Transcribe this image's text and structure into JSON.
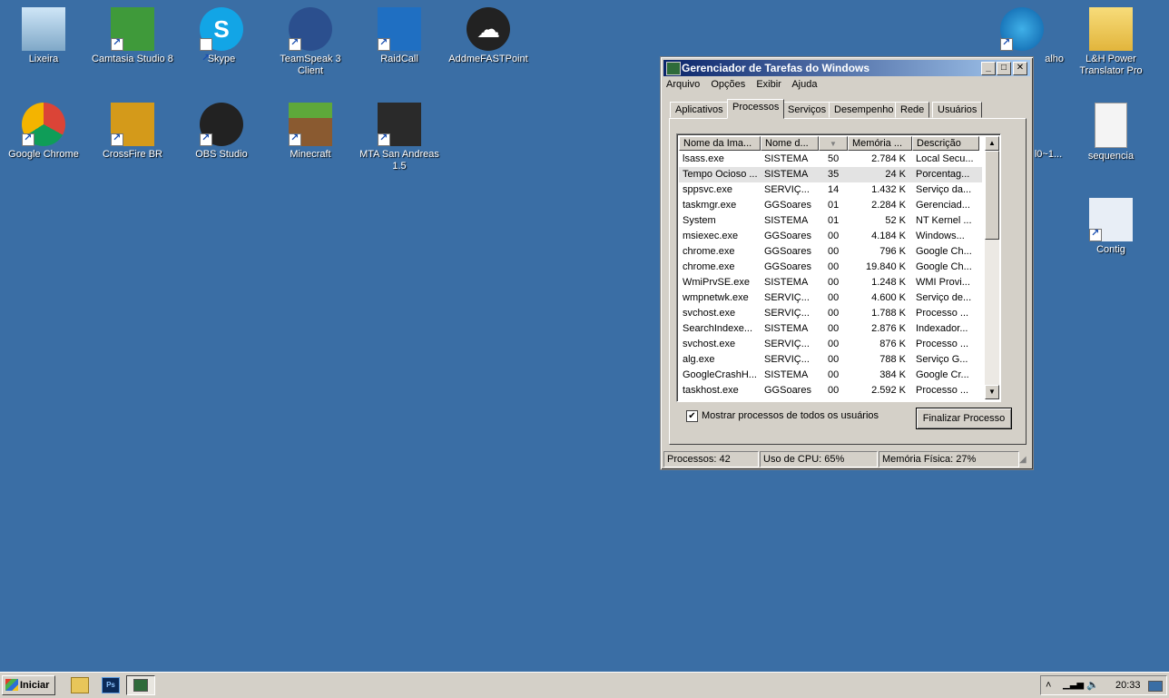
{
  "desktop_icons_left": [
    {
      "label": "Lixeira"
    },
    {
      "label": "Camtasia Studio 8"
    },
    {
      "label": "Skype"
    },
    {
      "label": "TeamSpeak 3 Client"
    },
    {
      "label": "RaidCall"
    },
    {
      "label": "AddmeFASTPoint"
    },
    {
      "label": "Google Chrome"
    },
    {
      "label": "CrossFire BR"
    },
    {
      "label": "OBS Studio"
    },
    {
      "label": "Minecraft"
    },
    {
      "label": "MTA San Andreas 1.5"
    }
  ],
  "desktop_icons_right": [
    {
      "label": "alho"
    },
    {
      "label": "L&H Power Translator Pro"
    },
    {
      "label": "l0~1..."
    },
    {
      "label": "sequencia"
    },
    {
      "label": "Contig"
    }
  ],
  "task_manager": {
    "title": "Gerenciador de Tarefas do Windows",
    "menu": [
      "Arquivo",
      "Opções",
      "Exibir",
      "Ajuda"
    ],
    "tabs": [
      "Aplicativos",
      "Processos",
      "Serviços",
      "Desempenho",
      "Rede",
      "Usuários"
    ],
    "active_tab": "Processos",
    "columns": [
      "Nome da Ima...",
      "Nome d...",
      "",
      "Memória ...",
      "Descrição"
    ],
    "rows": [
      {
        "name": "lsass.exe",
        "user": "SISTEMA",
        "cpu": "50",
        "mem": "2.784 K",
        "desc": "Local Secu..."
      },
      {
        "name": "Tempo Ocioso ...",
        "user": "SISTEMA",
        "cpu": "35",
        "mem": "24 K",
        "desc": "Porcentag..."
      },
      {
        "name": "sppsvc.exe",
        "user": "SERVIÇ...",
        "cpu": "14",
        "mem": "1.432 K",
        "desc": "Serviço da..."
      },
      {
        "name": "taskmgr.exe",
        "user": "GGSoares",
        "cpu": "01",
        "mem": "2.284 K",
        "desc": "Gerenciad..."
      },
      {
        "name": "System",
        "user": "SISTEMA",
        "cpu": "01",
        "mem": "52 K",
        "desc": "NT Kernel ..."
      },
      {
        "name": "msiexec.exe",
        "user": "GGSoares",
        "cpu": "00",
        "mem": "4.184 K",
        "desc": "Windows..."
      },
      {
        "name": "chrome.exe",
        "user": "GGSoares",
        "cpu": "00",
        "mem": "796 K",
        "desc": "Google Ch..."
      },
      {
        "name": "chrome.exe",
        "user": "GGSoares",
        "cpu": "00",
        "mem": "19.840 K",
        "desc": "Google Ch..."
      },
      {
        "name": "WmiPrvSE.exe",
        "user": "SISTEMA",
        "cpu": "00",
        "mem": "1.248 K",
        "desc": "WMI Provi..."
      },
      {
        "name": "wmpnetwk.exe",
        "user": "SERVIÇ...",
        "cpu": "00",
        "mem": "4.600 K",
        "desc": "Serviço de..."
      },
      {
        "name": "svchost.exe",
        "user": "SERVIÇ...",
        "cpu": "00",
        "mem": "1.788 K",
        "desc": "Processo ..."
      },
      {
        "name": "SearchIndexe...",
        "user": "SISTEMA",
        "cpu": "00",
        "mem": "2.876 K",
        "desc": "Indexador..."
      },
      {
        "name": "svchost.exe",
        "user": "SERVIÇ...",
        "cpu": "00",
        "mem": "876 K",
        "desc": "Processo ..."
      },
      {
        "name": "alg.exe",
        "user": "SERVIÇ...",
        "cpu": "00",
        "mem": "788 K",
        "desc": "Serviço G..."
      },
      {
        "name": "GoogleCrashH...",
        "user": "SISTEMA",
        "cpu": "00",
        "mem": "384 K",
        "desc": "Google Cr..."
      },
      {
        "name": "taskhost.exe",
        "user": "GGSoares",
        "cpu": "00",
        "mem": "2.592 K",
        "desc": "Processo ..."
      }
    ],
    "show_all_label": "Mostrar processos de todos os usuários",
    "show_all_checked": true,
    "end_process_label": "Finalizar Processo",
    "status": {
      "processes": "Processos: 42",
      "cpu": "Uso de CPU: 65%",
      "memory": "Memória Física: 27%"
    }
  },
  "taskbar": {
    "start_label": "Iniciar",
    "clock": "20:33"
  }
}
